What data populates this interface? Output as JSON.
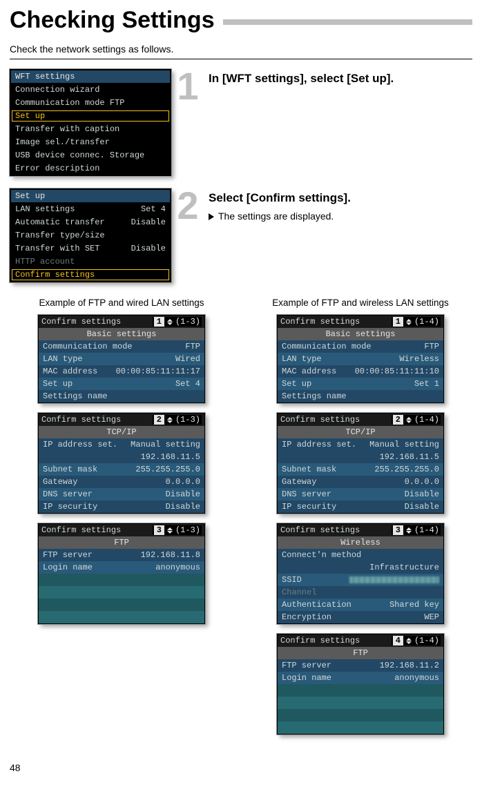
{
  "page": {
    "title": "Checking Settings",
    "intro": "Check the network settings as follows.",
    "number": "48"
  },
  "step1": {
    "num": "1",
    "heading": "In [WFT settings], select [Set up].",
    "lcd_title": "WFT settings",
    "items": [
      {
        "label": "Connection wizard",
        "dim": false
      },
      {
        "label": "Communication mode FTP",
        "dim": false
      },
      {
        "label": "Set up",
        "sel": true
      },
      {
        "label": "Transfer with caption",
        "dim": false
      },
      {
        "label": "Image sel./transfer",
        "dim": false
      },
      {
        "label": "USB device connec. Storage",
        "dim": false
      },
      {
        "label": "Error description",
        "dim": false
      }
    ]
  },
  "step2": {
    "num": "2",
    "heading": "Select [Confirm settings].",
    "line": "The settings are displayed.",
    "lcd_title": "Set up",
    "items": [
      {
        "label": "LAN settings",
        "val": "Set 4"
      },
      {
        "label": "Automatic transfer",
        "val": "Disable"
      },
      {
        "label": "Transfer type/size",
        "val": ""
      },
      {
        "label": "Transfer with SET",
        "val": "Disable"
      },
      {
        "label": "HTTP account",
        "val": "",
        "dim": true
      },
      {
        "label": "Confirm settings",
        "val": "",
        "sel": true
      }
    ]
  },
  "examples": {
    "left_caption": "Example of FTP and wired LAN settings",
    "right_caption": "Example of FTP and wireless LAN settings",
    "confirm_title": "Confirm settings",
    "left_total": "(1-3)",
    "right_total": "(1-4)",
    "left": {
      "p1": {
        "page": "1",
        "section": "Basic settings",
        "rows": [
          {
            "lab": "Communication mode",
            "val": "FTP"
          },
          {
            "lab": "LAN type",
            "val": "Wired"
          },
          {
            "lab": "MAC address",
            "val": "00:00:85:11:11:17"
          },
          {
            "lab": "Set up",
            "val": "Set 4"
          },
          {
            "lab": "Settings name",
            "val": ""
          }
        ]
      },
      "p2": {
        "page": "2",
        "section": "TCP/IP",
        "rows": [
          {
            "lab": "IP address set.",
            "val": "Manual setting"
          },
          {
            "lab": "",
            "val": "192.168.11.5"
          },
          {
            "lab": "Subnet mask",
            "val": "255.255.255.0"
          },
          {
            "lab": "Gateway",
            "val": "0.0.0.0"
          },
          {
            "lab": "DNS server",
            "val": "Disable"
          },
          {
            "lab": "IP security",
            "val": "Disable"
          }
        ]
      },
      "p3": {
        "page": "3",
        "section": "FTP",
        "rows": [
          {
            "lab": "FTP server",
            "val": "192.168.11.8"
          },
          {
            "lab": "Login name",
            "val": "anonymous"
          }
        ],
        "blank_rows": 4
      }
    },
    "right": {
      "p1": {
        "page": "1",
        "section": "Basic settings",
        "rows": [
          {
            "lab": "Communication mode",
            "val": "FTP"
          },
          {
            "lab": "LAN type",
            "val": "Wireless"
          },
          {
            "lab": "MAC address",
            "val": "00:00:85:11:11:10"
          },
          {
            "lab": "Set up",
            "val": "Set 1"
          },
          {
            "lab": "Settings name",
            "val": ""
          }
        ]
      },
      "p2": {
        "page": "2",
        "section": "TCP/IP",
        "rows": [
          {
            "lab": "IP address set.",
            "val": "Manual setting"
          },
          {
            "lab": "",
            "val": "192.168.11.5"
          },
          {
            "lab": "Subnet mask",
            "val": "255.255.255.0"
          },
          {
            "lab": "Gateway",
            "val": "0.0.0.0"
          },
          {
            "lab": "DNS server",
            "val": "Disable"
          },
          {
            "lab": "IP security",
            "val": "Disable"
          }
        ]
      },
      "p3": {
        "page": "3",
        "section": "Wireless",
        "rows": [
          {
            "lab": "Connect'n method",
            "val": ""
          },
          {
            "lab": "",
            "val": "Infrastructure"
          },
          {
            "lab": "SSID",
            "val": "[blur]"
          },
          {
            "lab": "Channel",
            "val": "",
            "dim": true
          },
          {
            "lab": "Authentication",
            "val": "Shared key"
          },
          {
            "lab": "Encryption",
            "val": "WEP"
          }
        ]
      },
      "p4": {
        "page": "4",
        "section": "FTP",
        "rows": [
          {
            "lab": "FTP server",
            "val": "192.168.11.2"
          },
          {
            "lab": "Login name",
            "val": "anonymous"
          }
        ],
        "blank_rows": 4
      }
    }
  }
}
